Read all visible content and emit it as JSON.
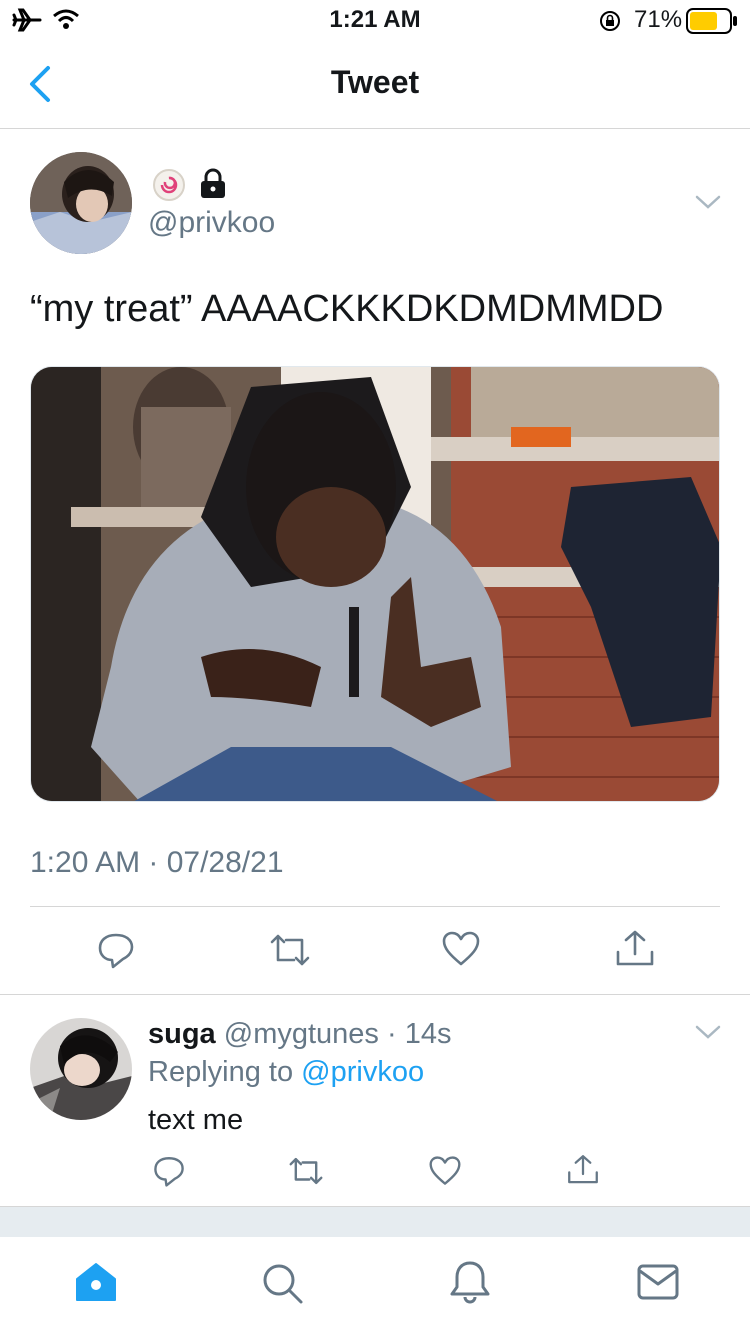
{
  "status_bar": {
    "time": "1:21 AM",
    "battery_percent": "71%",
    "battery_level": 0.71
  },
  "nav": {
    "title": "Tweet"
  },
  "tweet": {
    "handle": "@privkoo",
    "text": "“my treat” AAAACKKKDKDMDMMDD",
    "timestamp": "1:20 AM · 07/28/21",
    "actions": [
      "reply-icon",
      "retweet-icon",
      "like-icon",
      "share-icon"
    ]
  },
  "reply": {
    "name": "suga",
    "handle": "@mygtunes",
    "time": "14s",
    "replying_label": "Replying to",
    "replying_to": "@privkoo",
    "text": "text me"
  },
  "tabbar": {
    "items": [
      "home-icon",
      "search-icon",
      "notifications-icon",
      "messages-icon"
    ]
  },
  "colors": {
    "accent": "#1da1f2",
    "secondary_text": "#657786",
    "divider": "#d6d6d6",
    "battery": "#ffcc00"
  }
}
